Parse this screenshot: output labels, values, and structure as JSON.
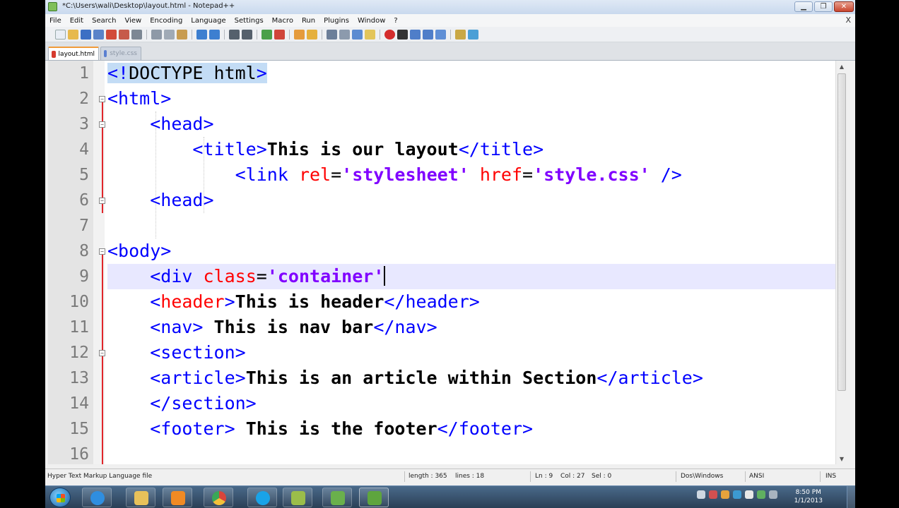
{
  "window": {
    "title": "*C:\\Users\\wali\\Desktop\\layout.html - Notepad++",
    "min_glyph": "▁",
    "max_glyph": "❐",
    "close_glyph": "✕"
  },
  "menu": {
    "items": [
      "File",
      "Edit",
      "Search",
      "View",
      "Encoding",
      "Language",
      "Settings",
      "Macro",
      "Run",
      "Plugins",
      "Window",
      "?"
    ],
    "close_label": "X"
  },
  "tabs": [
    {
      "label": "layout.html",
      "active": true,
      "icon_color": "#d63b2f"
    },
    {
      "label": "style.css",
      "active": false,
      "icon_color": "#5a7fd1"
    }
  ],
  "editor": {
    "current_line": 9,
    "lines": [
      {
        "n": "1"
      },
      {
        "n": "2"
      },
      {
        "n": "3"
      },
      {
        "n": "4"
      },
      {
        "n": "5"
      },
      {
        "n": "6"
      },
      {
        "n": "7"
      },
      {
        "n": "8"
      },
      {
        "n": "9"
      },
      {
        "n": "10"
      },
      {
        "n": "11"
      },
      {
        "n": "12"
      },
      {
        "n": "13"
      },
      {
        "n": "14"
      },
      {
        "n": "15"
      },
      {
        "n": "16"
      }
    ],
    "tokens": {
      "l1_open": "<!",
      "l1_doctype": "DOCTYPE html",
      "l1_close": ">",
      "l2": "<html>",
      "l3": "<head>",
      "l4_open": "<title>",
      "l4_text": "This is our layout",
      "l4_close": "</title>",
      "l5_open": "<link ",
      "l5_attr1": "rel",
      "l5_eq1": "=",
      "l5_val1": "'stylesheet'",
      "l5_attr2": " href",
      "l5_eq2": "=",
      "l5_val2": "'style.css'",
      "l5_close": " />",
      "l6": "<head>",
      "l8": "<body>",
      "l9_open": "<div ",
      "l9_attr": "class",
      "l9_eq": "=",
      "l9_val": "'container'",
      "l10_open": "<",
      "l10_tagname": "header",
      "l10_gt": ">",
      "l10_text": "This is header",
      "l10_close": "</header>",
      "l11_open": "<nav>",
      "l11_text": " This is nav bar",
      "l11_close": "</nav>",
      "l12": "<section>",
      "l13_open": "<article>",
      "l13_text": "This is an article within Section",
      "l13_close": "</article>",
      "l14": "</section>",
      "l15_open": "<footer>",
      "l15_text": " This is the footer",
      "l15_close": "</footer>"
    }
  },
  "status": {
    "filetype": "Hyper Text Markup Language file",
    "length": "length : 365",
    "lines": "lines : 18",
    "ln": "Ln : 9",
    "col": "Col : 27",
    "sel": "Sel : 0",
    "eol": "Dos\\Windows",
    "encoding": "ANSI",
    "mode": "INS"
  },
  "taskbar": {
    "clock_time": "8:50 PM",
    "clock_date": "1/1/2013",
    "apps": [
      {
        "name": "internet-explorer",
        "color": "#2f8ee0"
      },
      {
        "name": "file-explorer",
        "color": "#e8c15a"
      },
      {
        "name": "media-player",
        "color": "#f08a24"
      },
      {
        "name": "chrome",
        "color": "#d8453a"
      },
      {
        "name": "skype",
        "color": "#19a3e8"
      },
      {
        "name": "notes",
        "color": "#9bbd4a"
      },
      {
        "name": "editor",
        "color": "#6ab04c"
      },
      {
        "name": "notepad-plus-plus",
        "color": "#5ea53e"
      }
    ]
  }
}
